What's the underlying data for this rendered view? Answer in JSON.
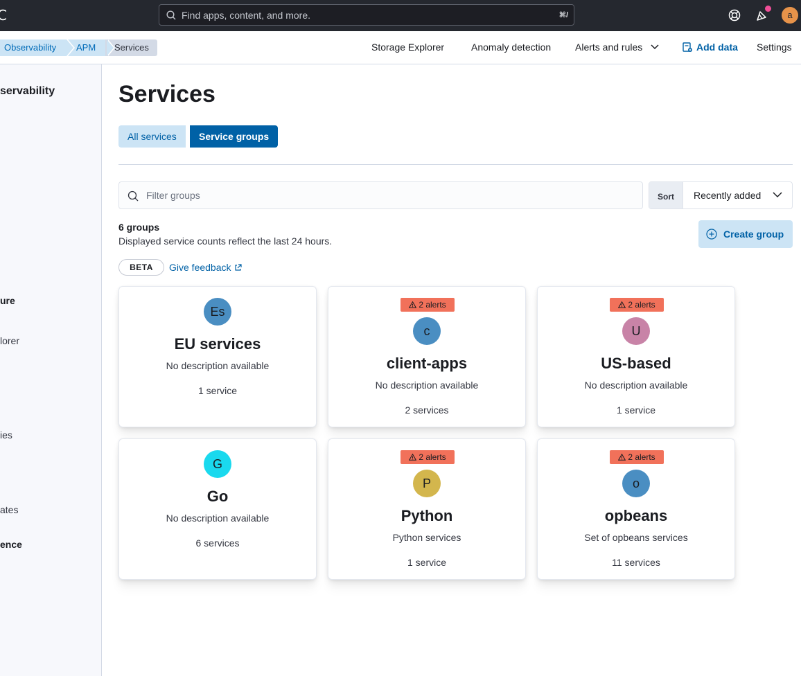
{
  "header": {
    "logo_fragment": "C",
    "search_placeholder": "Find apps, content, and more.",
    "search_shortcut": "⌘/",
    "avatar_initial": "a"
  },
  "breadcrumbs": [
    "Observability",
    "APM",
    "Services"
  ],
  "top_nav": {
    "storage_explorer": "Storage Explorer",
    "anomaly_detection": "Anomaly detection",
    "alerts_and_rules": "Alerts and rules",
    "add_data": "Add data",
    "settings": "Settings"
  },
  "sidenav": {
    "items": [
      "servability",
      "ure",
      "lorer",
      "ies",
      "ates",
      "ence"
    ]
  },
  "page": {
    "title": "Services",
    "tabs": {
      "all": "All services",
      "groups": "Service groups"
    },
    "filter_placeholder": "Filter groups",
    "sort_label": "Sort",
    "sort_value": "Recently added",
    "group_count": "6 groups",
    "count_note": "Displayed service counts reflect the last 24 hours.",
    "create_group": "Create group",
    "beta": "BETA",
    "feedback": "Give feedback"
  },
  "groups": [
    {
      "initials": "Es",
      "color": "#4a8ec2",
      "name": "EU services",
      "description": "No description available",
      "count": "1 service",
      "alerts": ""
    },
    {
      "initials": "c",
      "color": "#4a8ec2",
      "name": "client-apps",
      "description": "No description available",
      "count": "2 services",
      "alerts": "2 alerts"
    },
    {
      "initials": "U",
      "color": "#c883a7",
      "name": "US-based",
      "description": "No description available",
      "count": "1 service",
      "alerts": "2 alerts"
    },
    {
      "initials": "G",
      "color": "#1ad9ee",
      "name": "Go",
      "description": "No description available",
      "count": "6 services",
      "alerts": ""
    },
    {
      "initials": "P",
      "color": "#d3b64d",
      "name": "Python",
      "description": "Python services",
      "count": "1 service",
      "alerts": "2 alerts"
    },
    {
      "initials": "o",
      "color": "#4a8ec2",
      "name": "opbeans",
      "description": "Set of opbeans services",
      "count": "11 services",
      "alerts": "2 alerts"
    }
  ]
}
